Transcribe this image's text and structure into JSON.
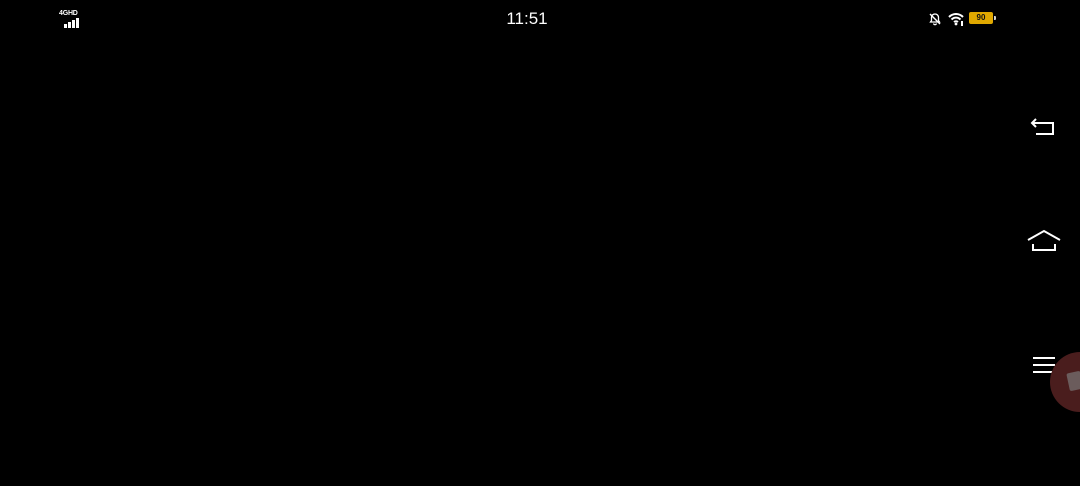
{
  "status_bar": {
    "network_type": "4GHD",
    "time": "11:51",
    "battery_level": "90",
    "battery_color": "#e0a800",
    "icons": [
      "signal-icon",
      "mute-icon",
      "wifi-icon",
      "battery-icon"
    ]
  },
  "navigation_bar": {
    "buttons": [
      {
        "name": "back",
        "icon": "back-icon"
      },
      {
        "name": "home",
        "icon": "home-icon"
      },
      {
        "name": "menu",
        "icon": "menu-icon"
      }
    ]
  },
  "floating_bubble": {
    "icon": "floating-bubble-icon",
    "color": "#4a1d1d"
  }
}
